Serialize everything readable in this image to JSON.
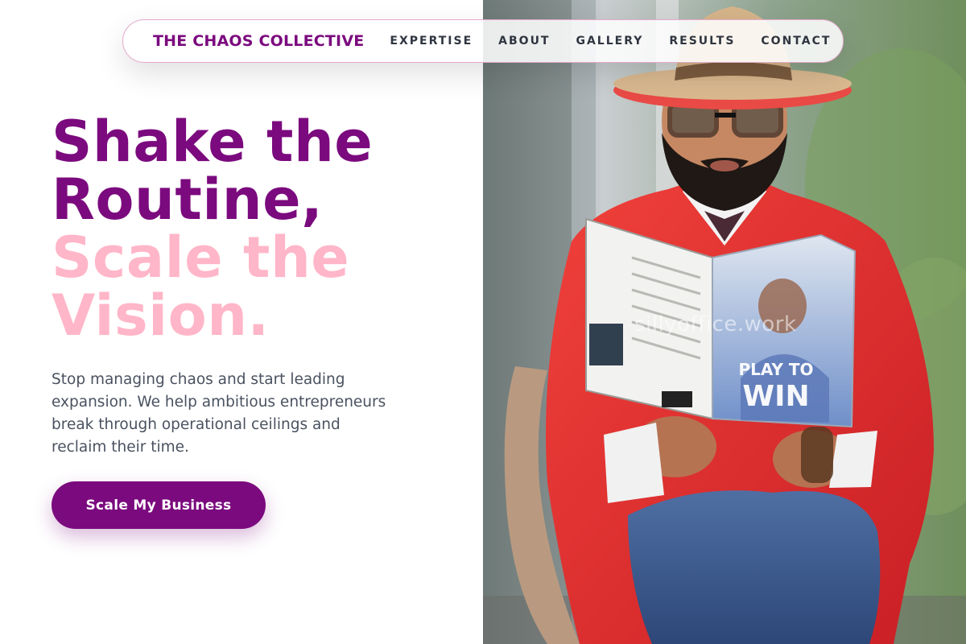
{
  "nav": {
    "brand": "THE CHAOS COLLECTIVE",
    "links": [
      "EXPERTISE",
      "ABOUT",
      "GALLERY",
      "RESULTS",
      "CONTACT"
    ]
  },
  "hero": {
    "headline_line1": "Shake the",
    "headline_line2": "Routine,",
    "headline_line3": "Scale the",
    "headline_line4": "Vision.",
    "subtext": "Stop managing chaos and start leading expansion. We help ambitious entrepreneurs break through operational ceilings and reclaim their time.",
    "cta_label": "Scale My Business"
  },
  "photo": {
    "watermark": "sillyoffice.work",
    "book_title_line1": "PLAY TO",
    "book_title_line2": "WIN"
  },
  "colors": {
    "brand_purple": "#7b0a7e",
    "accent_pink": "#ffb6c8",
    "jacket_red": "#e02a2a"
  }
}
